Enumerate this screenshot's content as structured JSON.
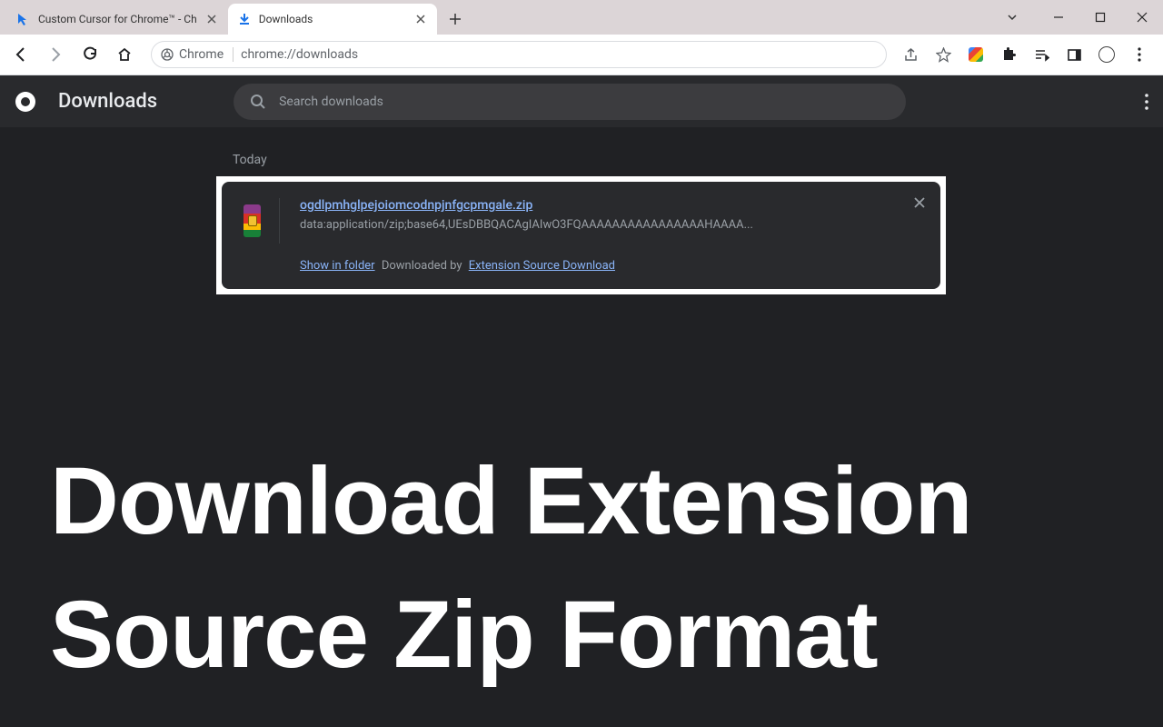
{
  "window": {
    "tabs": [
      {
        "title": "Custom Cursor for Chrome™ - Ch"
      },
      {
        "title": "Downloads"
      }
    ]
  },
  "urlbar": {
    "chip": "Chrome",
    "url": "chrome://downloads"
  },
  "downloads_header": {
    "title": "Downloads",
    "search_placeholder": "Search downloads"
  },
  "section": {
    "label": "Today"
  },
  "download_item": {
    "filename": "ogdlpmhglpejoiomcodnpjnfgcpmgale.zip",
    "source": "data:application/zip;base64,UEsDBBQACAgIAIwO3FQAAAAAAAAAAAAAAAAHAAAA...",
    "show_in_folder": "Show in folder",
    "downloaded_by_prefix": "Downloaded by",
    "downloaded_by_link": "Extension Source Download"
  },
  "overlay": {
    "line1": "Download Extension",
    "line2": "Source Zip Format"
  }
}
